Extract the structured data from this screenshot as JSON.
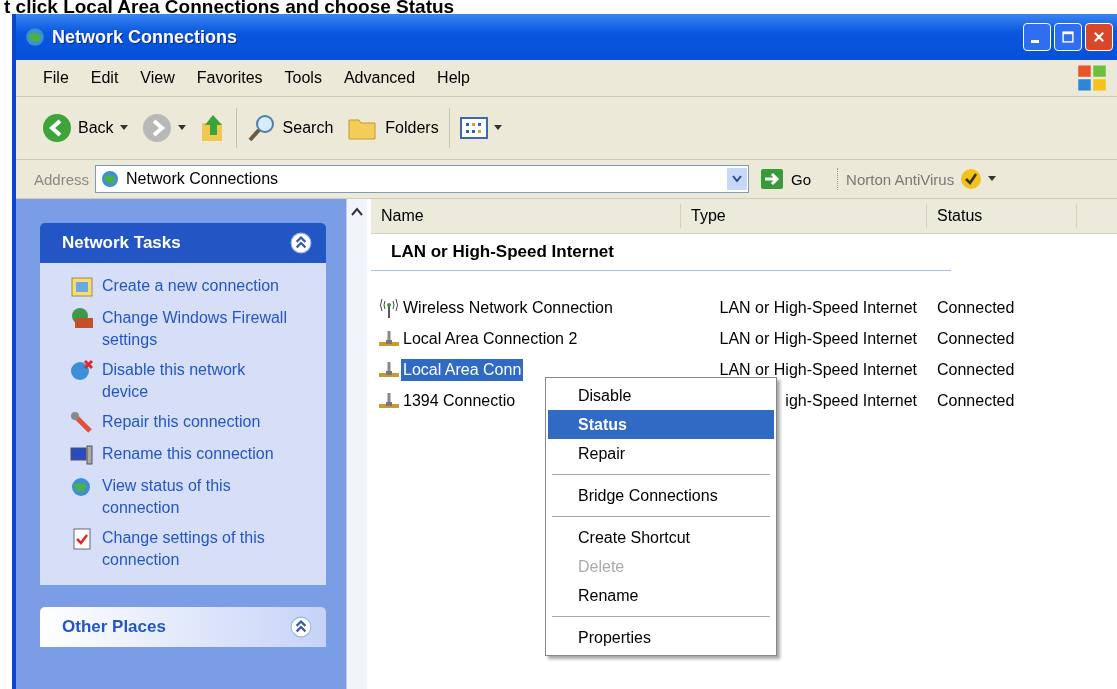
{
  "heading": "t click Local Area Connections and choose Status",
  "window": {
    "title": "Network Connections"
  },
  "menu_bar": [
    "File",
    "Edit",
    "View",
    "Favorites",
    "Tools",
    "Advanced",
    "Help"
  ],
  "toolbar": {
    "back": "Back",
    "search": "Search",
    "folders": "Folders"
  },
  "address_bar": {
    "label": "Address",
    "value": "Network Connections",
    "go": "Go",
    "norton": "Norton AntiVirus"
  },
  "task_panels": [
    {
      "title": "Network Tasks",
      "expanded": true,
      "items": [
        {
          "kind": "new",
          "label": "Create a new connection"
        },
        {
          "kind": "firewall",
          "label": "Change Windows Firewall settings"
        },
        {
          "kind": "disable",
          "label": "Disable this network device"
        },
        {
          "kind": "repair",
          "label": "Repair this connection"
        },
        {
          "kind": "rename",
          "label": "Rename this connection"
        },
        {
          "kind": "status",
          "label": "View status of this connection"
        },
        {
          "kind": "settings",
          "label": "Change settings of this connection"
        }
      ]
    },
    {
      "title": "Other Places",
      "expanded": true
    }
  ],
  "table": {
    "columns": [
      "Name",
      "Type",
      "Status"
    ],
    "group": "LAN or High-Speed Internet",
    "rows": [
      {
        "kind": "wireless",
        "name": "Wireless Network Connection",
        "type": "LAN or High-Speed Internet",
        "status": "Connected",
        "selected": false
      },
      {
        "kind": "wired",
        "name": "Local Area Connection 2",
        "type": "LAN or High-Speed Internet",
        "status": "Connected",
        "selected": false
      },
      {
        "kind": "wired",
        "name": "Local Area Conn",
        "type": "LAN or High-Speed Internet",
        "status": "Connected",
        "selected": true
      },
      {
        "kind": "wired",
        "name": "1394 Connectio",
        "type": "igh-Speed Internet",
        "status": "Connected",
        "selected": false
      }
    ]
  },
  "context_menu": [
    [
      {
        "label": "Disable",
        "selected": false,
        "disabled": false
      },
      {
        "label": "Status",
        "selected": true,
        "disabled": false
      },
      {
        "label": "Repair",
        "selected": false,
        "disabled": false
      }
    ],
    [
      {
        "label": "Bridge Connections",
        "selected": false,
        "disabled": false
      }
    ],
    [
      {
        "label": "Create Shortcut",
        "selected": false,
        "disabled": false
      },
      {
        "label": "Delete",
        "selected": false,
        "disabled": true
      },
      {
        "label": "Rename",
        "selected": false,
        "disabled": false
      }
    ],
    [
      {
        "label": "Properties",
        "selected": false,
        "disabled": false
      }
    ]
  ]
}
